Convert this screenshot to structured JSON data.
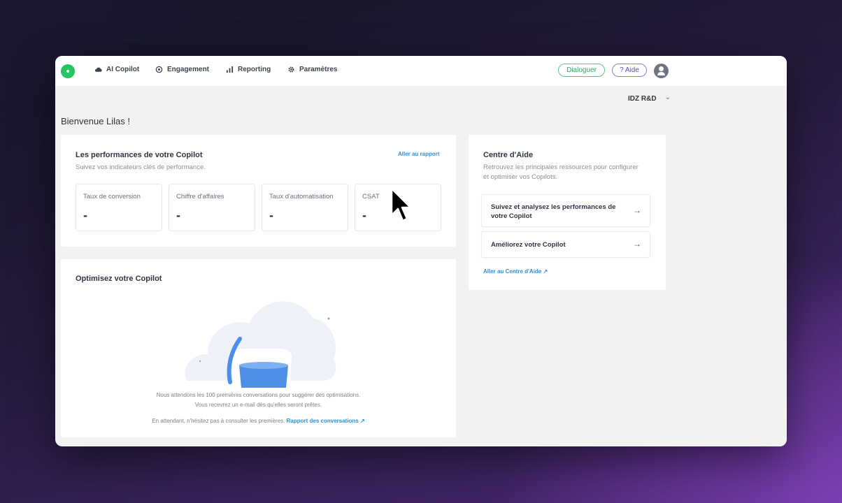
{
  "nav": {
    "ai_copilot": "AI Copilot",
    "engagement": "Engagement",
    "reporting": "Reporting",
    "parametres": "Paramètres"
  },
  "header": {
    "dialoguer": "Dialoguer",
    "aide": "? Aide"
  },
  "org_selector": {
    "name": "IDZ R&D",
    "chevron": "⌄"
  },
  "welcome": "Bienvenue Lilas !",
  "performance": {
    "title": "Les performances de votre Copilot",
    "subtitle": "Suivez vos indicateurs clés de performance.",
    "report_link": "Aller au rapport",
    "kpis": [
      {
        "label": "Taux de conversion",
        "value": "-"
      },
      {
        "label": "Chiffre d'affaires",
        "value": "-"
      },
      {
        "label": "Taux d'automatisation",
        "value": "-"
      },
      {
        "label": "CSAT",
        "value": "-"
      }
    ]
  },
  "help_center": {
    "title": "Centre d'Aide",
    "subtitle_1": "Retrouvez les principales ressources pour configurer",
    "subtitle_2": "et optimiser vos Copilots.",
    "item_1_line_1": "Suivez et analysez les performances de",
    "item_1_line_2": "votre Copilot",
    "item_2": "Améliorez votre Copilot",
    "arrow": "→",
    "link": "Aller au Centre d'Aide ↗"
  },
  "optimize": {
    "title": "Optimisez votre Copilot",
    "line_1": "Nous attendons les 100 premières conversations pour suggérer des optimisations.",
    "line_2": "Vous recevrez un e-mail dès qu'elles seront prêtes.",
    "line_3": "En attendant, n'hésitez pas à consulter les premières.",
    "link": "Rapport des conversations ↗"
  },
  "colors": {
    "brand_green": "#22c55e",
    "link_blue": "#2d8fd8",
    "help_purple": "#5a4bc9"
  },
  "icons": [
    "brand-logo-icon",
    "cloud-icon",
    "target-icon",
    "bar-chart-icon",
    "gear-icon",
    "user-icon",
    "chevron-down-icon",
    "arrow-right-icon",
    "mouse-cursor-icon"
  ]
}
